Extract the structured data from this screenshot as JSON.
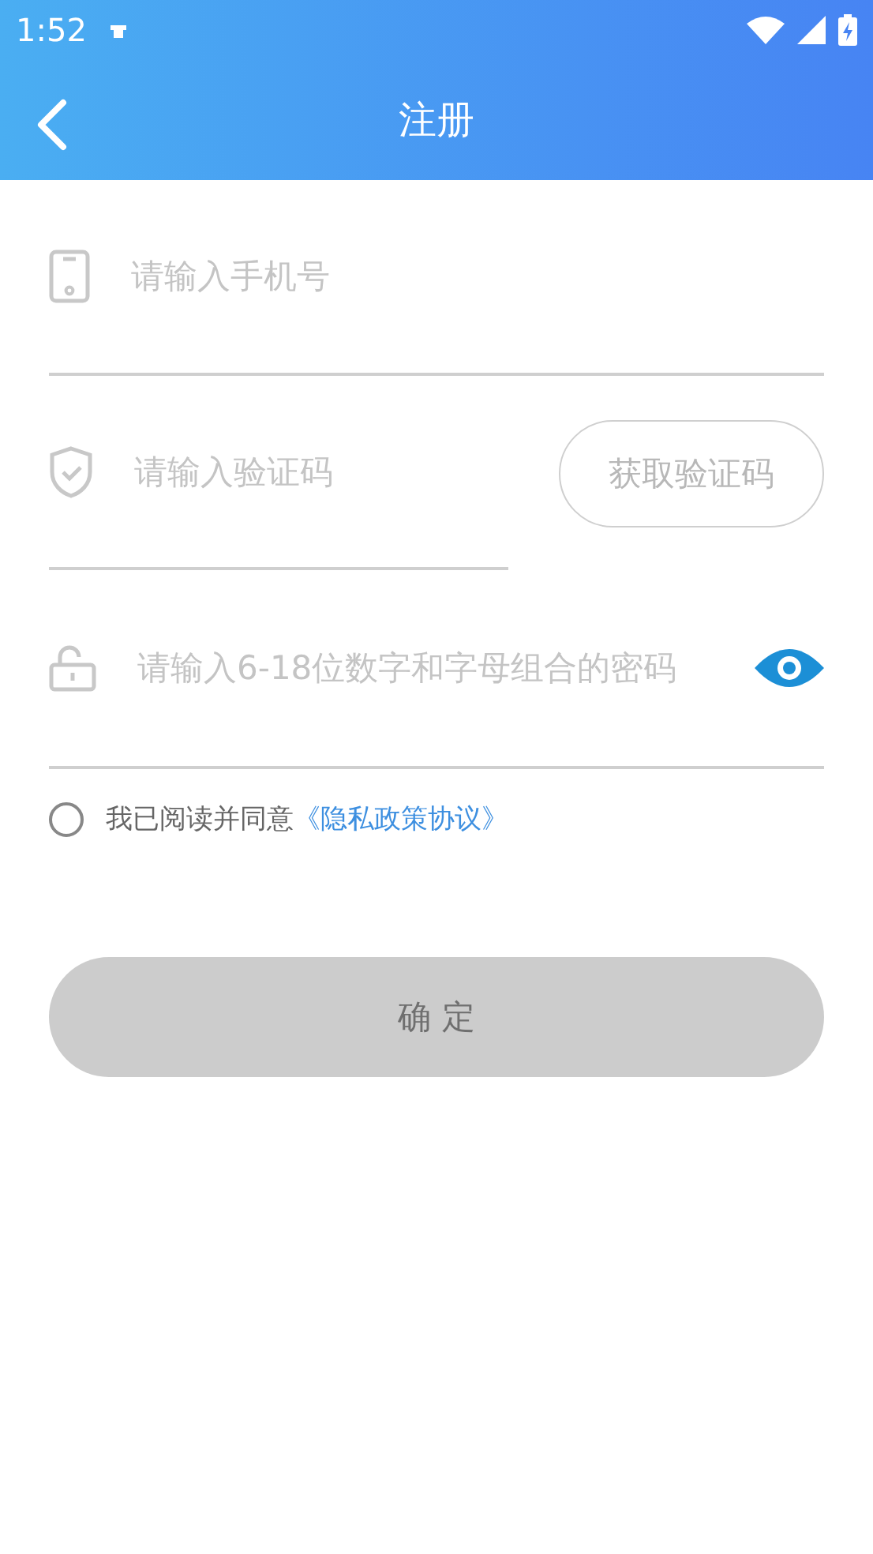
{
  "status_bar": {
    "time": "1:52"
  },
  "header": {
    "title": "注册"
  },
  "form": {
    "phone": {
      "placeholder": "请输入手机号"
    },
    "code": {
      "placeholder": "请输入验证码",
      "button": "获取验证码"
    },
    "password": {
      "placeholder": "请输入6-18位数字和字母组合的密码"
    },
    "agreement": {
      "checked": false,
      "text": "我已阅读并同意",
      "link": "《隐私政策协议》"
    },
    "submit": {
      "label": "确 定",
      "disabled": true
    }
  }
}
